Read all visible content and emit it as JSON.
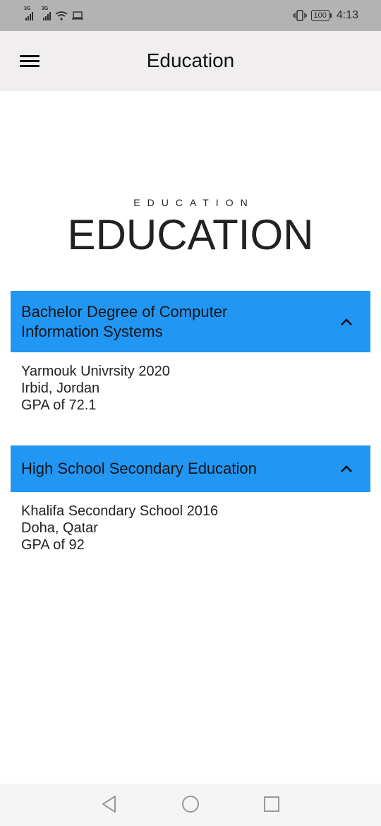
{
  "status_bar": {
    "network_1": "3G",
    "network_2": "3G",
    "battery": "100",
    "time": "4:13",
    "icons": [
      "signal-icon",
      "signal-icon",
      "wifi-icon",
      "laptop-icon",
      "vibrate-icon",
      "battery-icon"
    ]
  },
  "app_bar": {
    "title": "Education",
    "menu_icon": "menu-icon"
  },
  "section": {
    "overline": "EDUCATION",
    "title": "EDUCATION"
  },
  "panels": [
    {
      "title": "Bachelor Degree of Computer Information Systems",
      "expanded": true,
      "lines": [
        "Yarmouk Univrsity 2020",
        "Irbid, Jordan",
        "GPA of 72.1"
      ]
    },
    {
      "title": "High School Secondary Education",
      "expanded": true,
      "lines": [
        "Khalifa Secondary School 2016",
        "Doha, Qatar",
        "GPA of 92"
      ]
    }
  ],
  "nav_bar": {
    "icons": [
      "back-icon",
      "home-icon",
      "recents-icon"
    ]
  },
  "colors": {
    "accent": "#2196f3",
    "app_bar": "#f0eeee",
    "status_bar": "#b3b3b3"
  }
}
